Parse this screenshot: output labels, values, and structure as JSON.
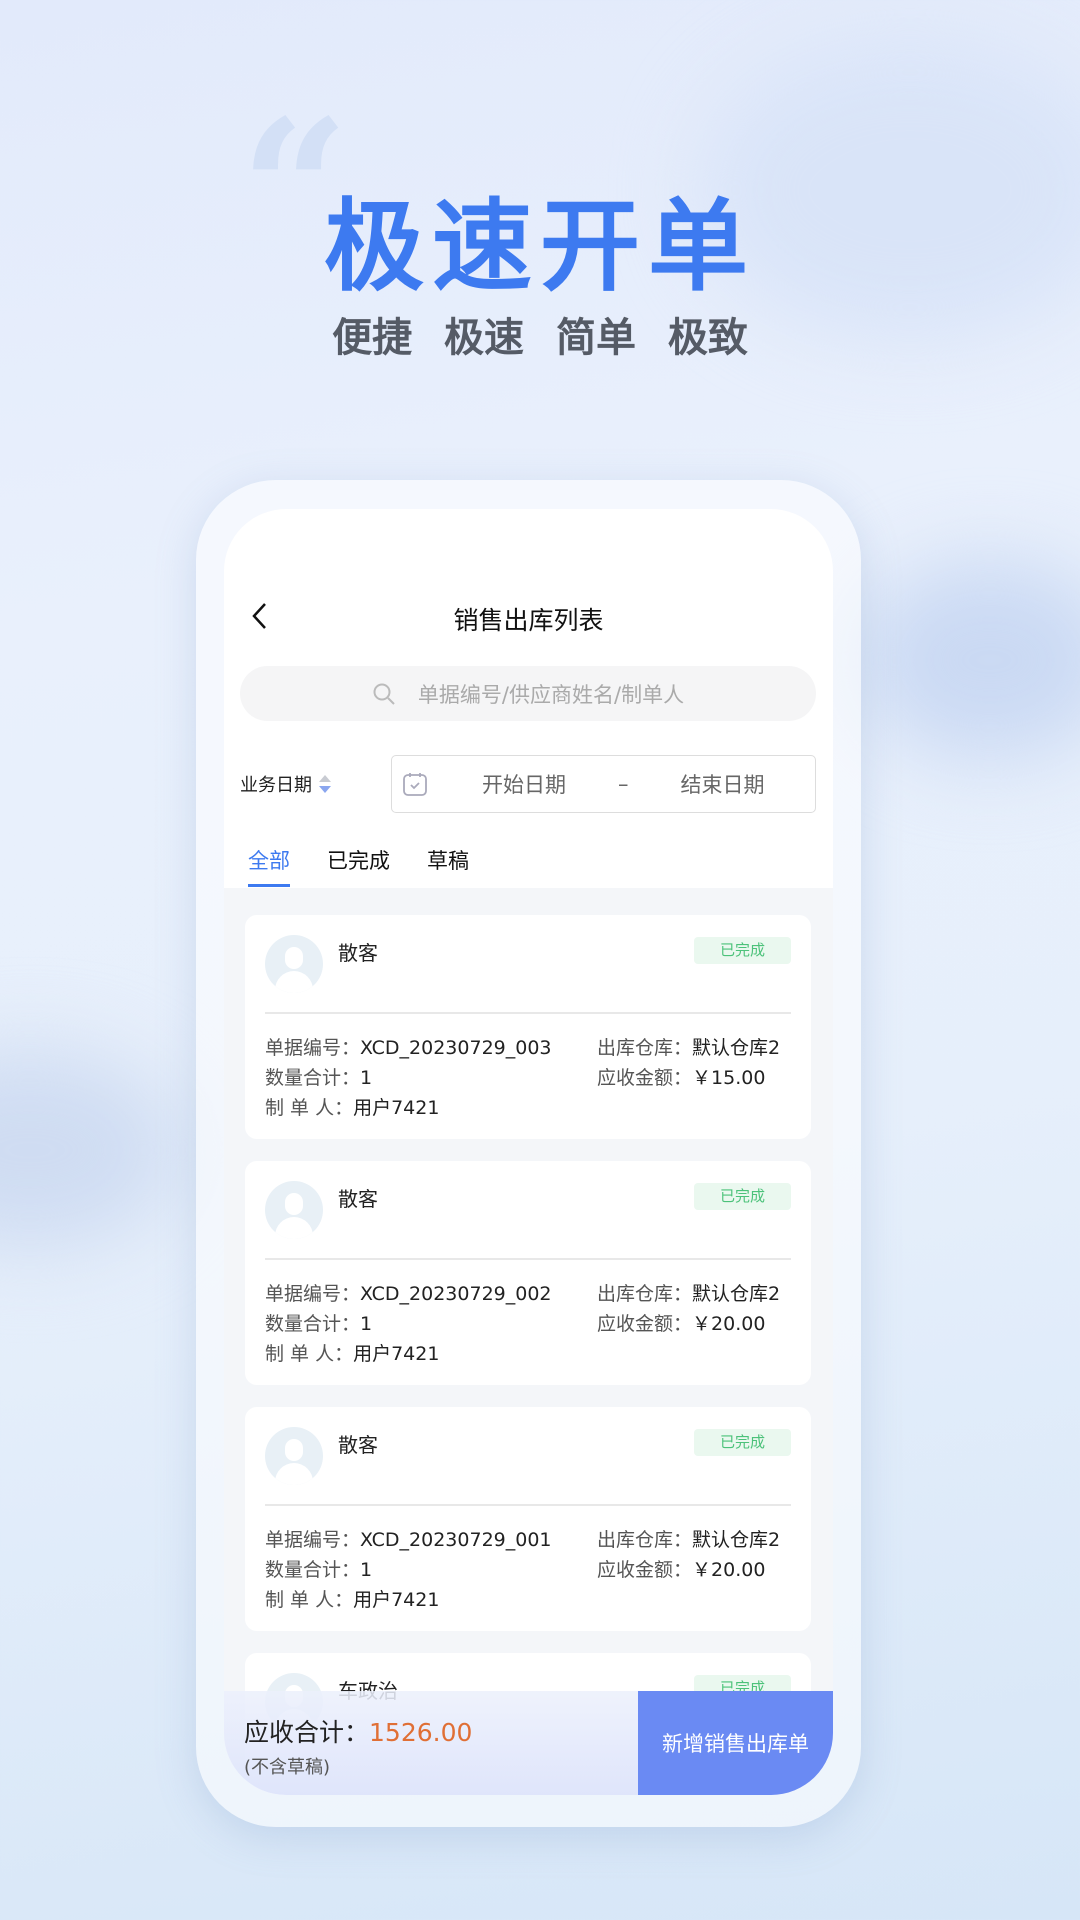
{
  "hero": {
    "quote_mark": "“",
    "title": "极速开单",
    "subtitle": "便捷 极速 简单 极致"
  },
  "colors": {
    "accent": "#3d7af0",
    "button": "#6a8af3",
    "status_green": "#4cc27a",
    "amount_orange": "#e06f35"
  },
  "nav": {
    "title": "销售出库列表",
    "back_icon": "chevron-left-icon"
  },
  "search": {
    "placeholder": "单据编号/供应商姓名/制单人"
  },
  "filter": {
    "label": "业务日期",
    "start_placeholder": "开始日期",
    "separator": "–",
    "end_placeholder": "结束日期"
  },
  "tabs": [
    {
      "label": "全部",
      "active": true
    },
    {
      "label": "已完成"
    },
    {
      "label": "草稿"
    }
  ],
  "labels": {
    "order_no": "单据编号：",
    "qty": "数量合计：",
    "maker": "制 单 人：",
    "warehouse": "出库仓库：",
    "amount": "应收金额："
  },
  "orders": [
    {
      "customer": "散客",
      "status": "已完成",
      "order_no": "XCD_20230729_003",
      "qty": "1",
      "maker": "用户7421",
      "warehouse": "默认仓库2",
      "amount": "￥15.00"
    },
    {
      "customer": "散客",
      "status": "已完成",
      "order_no": "XCD_20230729_002",
      "qty": "1",
      "maker": "用户7421",
      "warehouse": "默认仓库2",
      "amount": "￥20.00"
    },
    {
      "customer": "散客",
      "status": "已完成",
      "order_no": "XCD_20230729_001",
      "qty": "1",
      "maker": "用户7421",
      "warehouse": "默认仓库2",
      "amount": "￥20.00"
    },
    {
      "customer": "车政治",
      "status": "已完成"
    }
  ],
  "footer": {
    "total_label": "应收合计：",
    "total_value": "1526.00",
    "note": "(不含草稿)",
    "add_button": "新增销售出库单"
  }
}
